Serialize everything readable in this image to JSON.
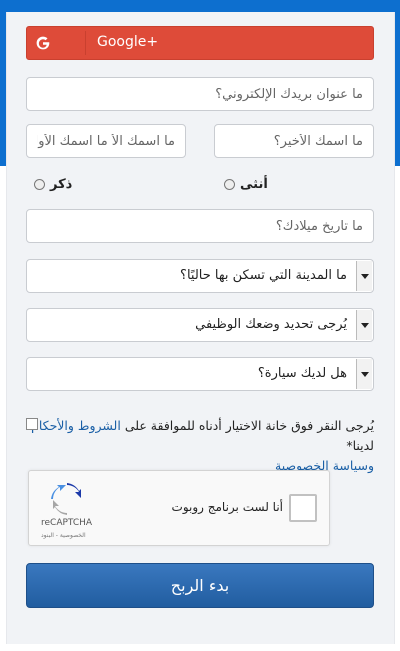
{
  "social": {
    "google_label": "Google+"
  },
  "fields": {
    "email_placeholder": "ما عنوان بريدك الإلكتروني؟",
    "last_name_placeholder": "ما اسمك الأخير؟",
    "first_name_placeholder": "ما اسمك الأ ما اسمك الأول؟",
    "dob_placeholder": "ما تاريخ ميلادك؟"
  },
  "gender": {
    "female_label": "أنثى",
    "male_label": "ذكر"
  },
  "selects": {
    "city": "ما المدينة التي تسكن بها حاليًا؟",
    "job": "يُرجى تحديد وضعك الوظيفي",
    "car": "هل لديك سيارة؟"
  },
  "terms": {
    "text_before": "يُرجى النقر فوق خانة الاختيار أدناه للموافقة على ",
    "terms_link": "الشروط والأحكام",
    "text_middle": " لدينا*",
    "privacy_link": "وسياسة الخصوصية"
  },
  "captcha": {
    "label": "أنا لست برنامج روبوت",
    "brand": "reCAPTCHA",
    "links": "الخصوصية - البنود"
  },
  "submit_label": "بدء الربح",
  "colors": {
    "header_blue": "#0d6fcf",
    "google_red": "#de4b39",
    "submit_blue": "#2a6ab3",
    "link_blue": "#1a5fa6"
  }
}
